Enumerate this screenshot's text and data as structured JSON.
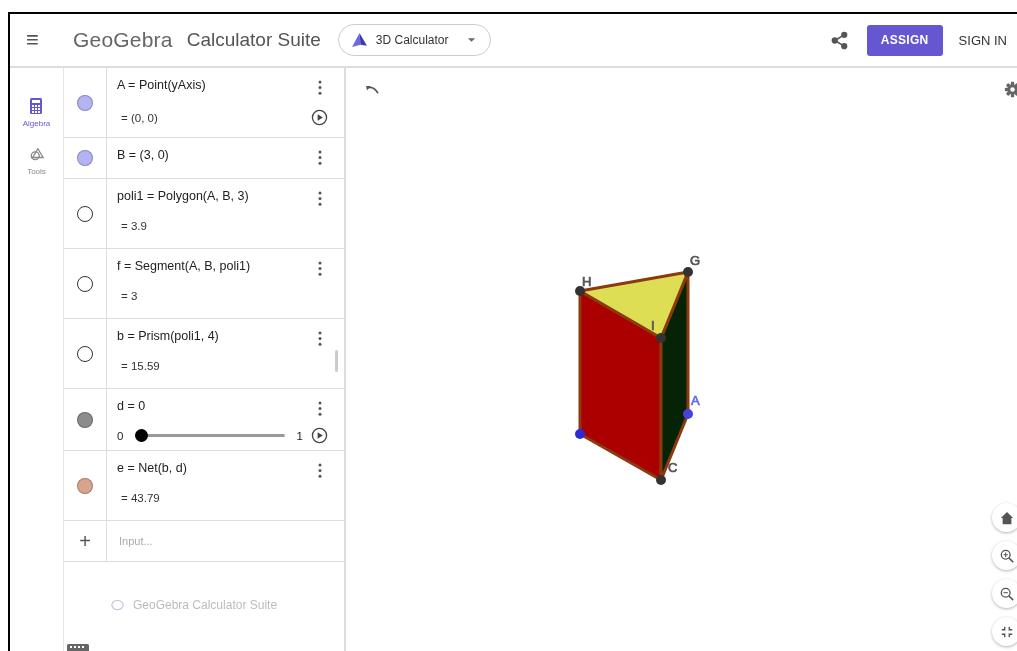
{
  "header": {
    "menu_icon": "≡",
    "logo": "GeoGebra",
    "title": "Calculator Suite",
    "app_switcher": {
      "label": "3D Calculator"
    },
    "assign_button": "ASSIGN",
    "sign_in": "SIGN IN"
  },
  "rail": [
    {
      "label": "Algebra",
      "selected": true
    },
    {
      "label": "Tools",
      "selected": false
    }
  ],
  "algebra": [
    {
      "kind": "expression",
      "color": "#b4b4f5",
      "visible": true,
      "definition": "A = Point(yAxis)",
      "value": "= (0, 0)",
      "play_button": true
    },
    {
      "kind": "point",
      "color": "#b4b4f5",
      "visible": true,
      "definition": "B = (3, 0)"
    },
    {
      "kind": "expression",
      "visible": false,
      "definition": "poli1 = Polygon(A, B, 3)",
      "value": "= 3.9"
    },
    {
      "kind": "expression",
      "visible": false,
      "definition": "f = Segment(A, B, poli1)",
      "value": "= 3"
    },
    {
      "kind": "expression",
      "visible": false,
      "definition": "b = Prism(poli1, 4)",
      "value": "= 15.59"
    },
    {
      "kind": "slider",
      "color": "#8c8c8c",
      "visible": true,
      "definition": "d = 0",
      "min": "0",
      "max": "1",
      "level": 0,
      "play_button": true
    },
    {
      "kind": "expression",
      "color": "#d9a48c",
      "visible": true,
      "definition": "e = Net(b, d)",
      "value": "= 43.79"
    }
  ],
  "input": {
    "add_icon": "+",
    "placeholder": "Input..."
  },
  "footer_brand": "GeoGebra Calculator Suite",
  "graphics": {
    "point_labels": [
      {
        "text": "H",
        "color": "#555555"
      },
      {
        "text": "G",
        "color": "#555555"
      },
      {
        "text": "I",
        "color": "#555555"
      },
      {
        "text": "A",
        "color": "#6666ee"
      },
      {
        "text": "C",
        "color": "#555555"
      }
    ]
  }
}
